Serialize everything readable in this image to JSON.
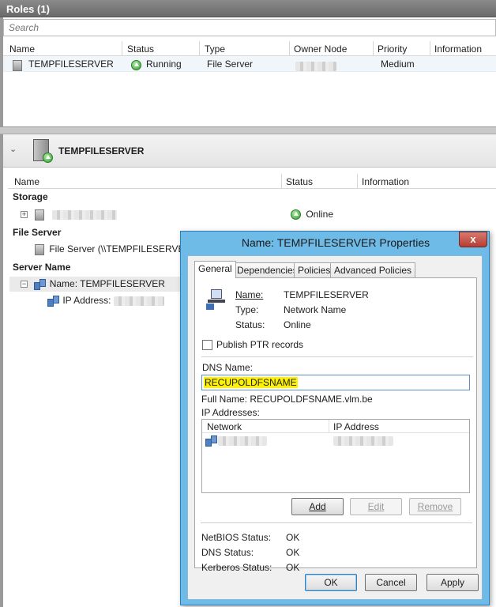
{
  "roles": {
    "header_title": "Roles (1)",
    "search_placeholder": "Search",
    "columns": [
      "Name",
      "Status",
      "Type",
      "Owner Node",
      "Priority",
      "Information"
    ],
    "rows": [
      {
        "name": "TEMPFILESERVER",
        "status": "Running",
        "type": "File Server",
        "owner_node": "",
        "priority": "Medium",
        "information": ""
      }
    ]
  },
  "detail": {
    "title": "TEMPFILESERVER",
    "columns": [
      "Name",
      "Status",
      "Information"
    ],
    "groups": {
      "storage": {
        "label": "Storage",
        "items": [
          {
            "name": "",
            "status": "Online"
          }
        ]
      },
      "file_server": {
        "label": "File Server",
        "items": [
          {
            "name": "File Server (\\\\TEMPFILESERVER)"
          }
        ]
      },
      "server_name": {
        "label": "Server Name",
        "items": [
          {
            "name": "Name: TEMPFILESERVER"
          },
          {
            "name": "IP Address:"
          }
        ]
      }
    }
  },
  "dialog": {
    "title": "Name: TEMPFILESERVER Properties",
    "close_label": "x",
    "tabs": [
      "General",
      "Dependencies",
      "Policies",
      "Advanced Policies"
    ],
    "general": {
      "name_label": "Name:",
      "name_value": "TEMPFILESERVER",
      "type_label": "Type:",
      "type_value": "Network Name",
      "status_label": "Status:",
      "status_value": "Online",
      "publish_ptr_label": "Publish PTR records",
      "publish_ptr_checked": false,
      "dns_name_label": "DNS Name:",
      "dns_name_value": "RECUPOLDFSNAME",
      "full_name": "Full Name: RECUPOLDFSNAME.vlm.be",
      "ip_addresses_label": "IP Addresses:",
      "ip_columns": [
        "Network",
        "IP Address"
      ],
      "add_label": "Add",
      "edit_label": "Edit",
      "remove_label": "Remove",
      "netbios_label": "NetBIOS Status:",
      "netbios_value": "OK",
      "dns_status_label": "DNS Status:",
      "dns_status_value": "OK",
      "kerberos_label": "Kerberos Status:",
      "kerberos_value": "OK"
    },
    "ok_label": "OK",
    "cancel_label": "Cancel",
    "apply_label": "Apply"
  },
  "colors": {
    "dialog_frame": "#6fbbe8",
    "close_button": "#c24a3f",
    "dns_highlight": "#fff200",
    "header_gray": "#7a7a7a"
  }
}
